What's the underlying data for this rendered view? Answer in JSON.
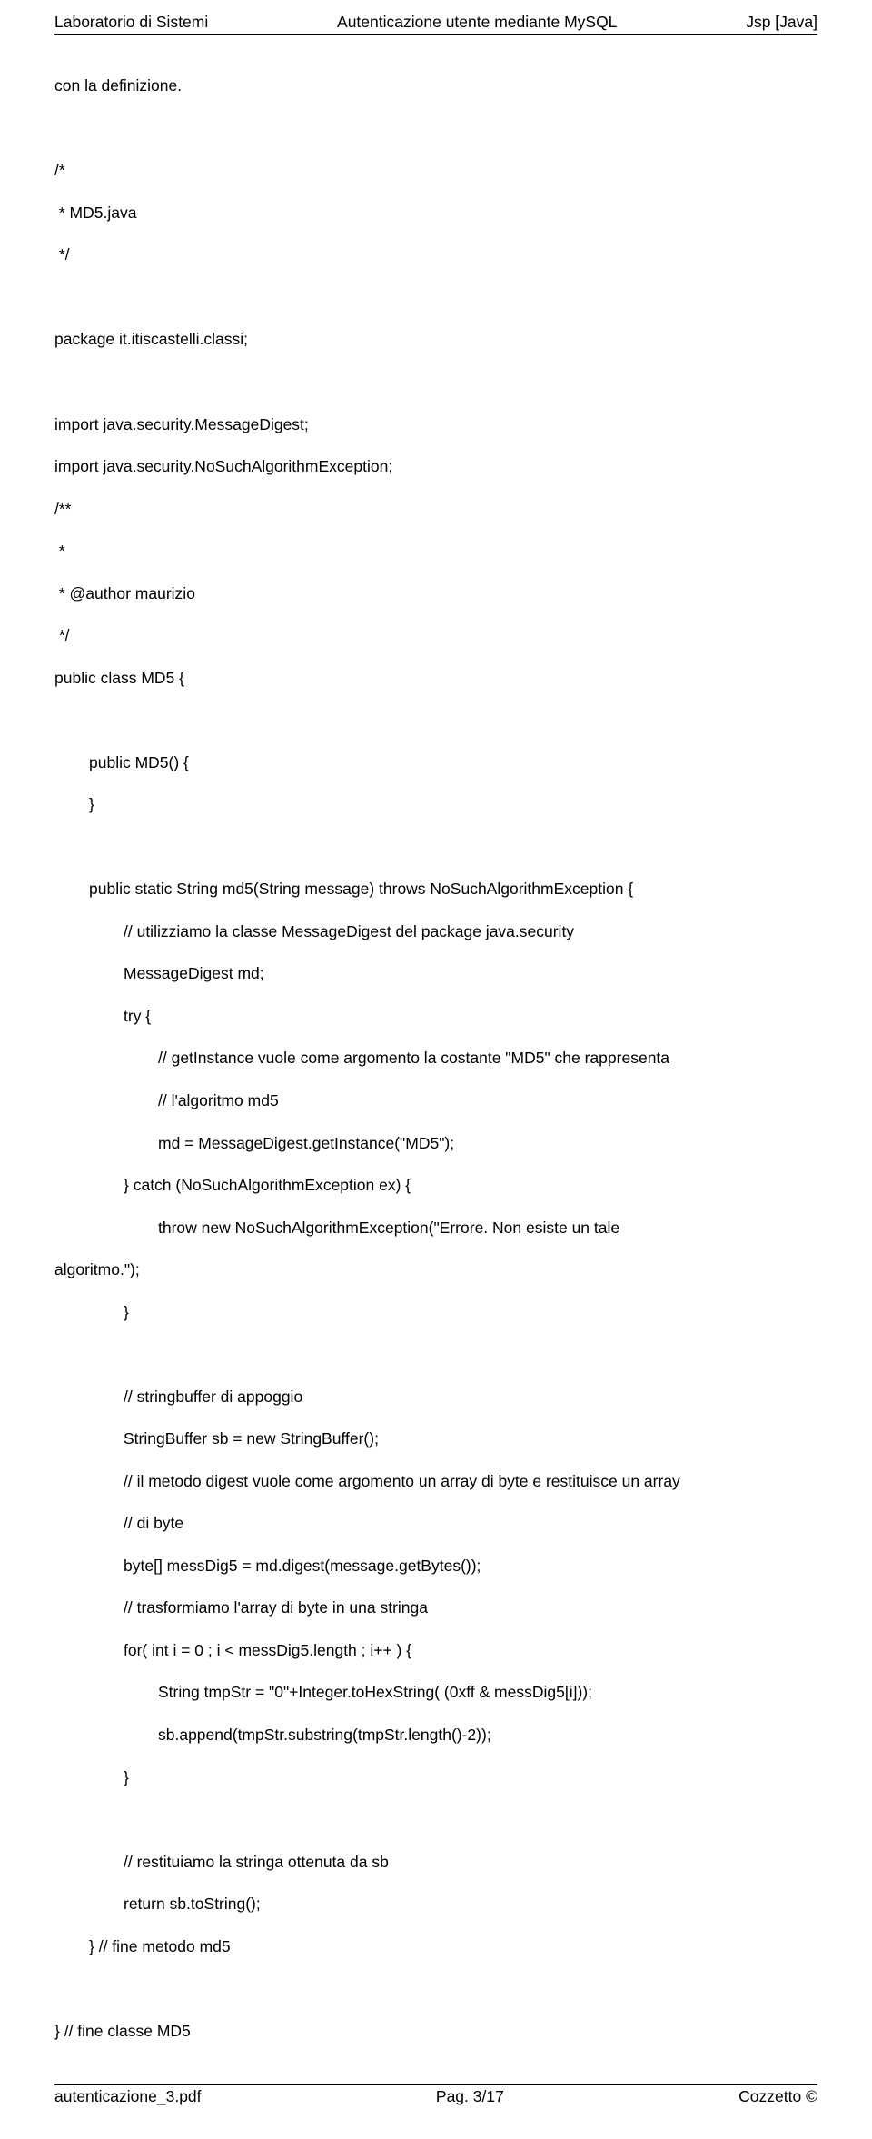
{
  "header": {
    "left": "Laboratorio di Sistemi",
    "center": "Autenticazione utente mediante MySQL",
    "right": "Jsp [Java]"
  },
  "intro": "con la definizione.",
  "code": {
    "c1": "/*",
    "c2": " * MD5.java",
    "c3": " */",
    "pkg": "package it.itiscastelli.classi;",
    "imp1": "import java.security.MessageDigest;",
    "imp2": "import java.security.NoSuchAlgorithmException;",
    "doc1": "/**",
    "doc2": " *",
    "doc3": " * @author maurizio",
    "doc4": " */",
    "cls1": "public class MD5 {",
    "ctor1": "public MD5() {",
    "ctor2": "}",
    "m1": "public static String md5(String message) throws NoSuchAlgorithmException {",
    "m2": "// utilizziamo la classe MessageDigest del package java.security",
    "m3": "MessageDigest md;",
    "m4": "try {",
    "m5": "// getInstance vuole come argomento la costante \"MD5\" che rappresenta",
    "m6": "// l'algoritmo md5",
    "m7": "md = MessageDigest.getInstance(\"MD5\");",
    "m8": "} catch (NoSuchAlgorithmException ex) {",
    "m9": "throw new NoSuchAlgorithmException(\"Errore. Non esiste un tale",
    "m9b": "algoritmo.\");",
    "m10": "}",
    "m11": "// stringbuffer di appoggio",
    "m12": "StringBuffer sb = new StringBuffer();",
    "m13": "// il metodo digest vuole come argomento un array di byte e restituisce un array",
    "m14": "// di byte",
    "m15": "byte[] messDig5 = md.digest(message.getBytes());",
    "m16": "// trasformiamo l'array di byte in una stringa",
    "m17": "for( int i = 0 ; i < messDig5.length ; i++ ) {",
    "m18": "String tmpStr = \"0\"+Integer.toHexString( (0xff & messDig5[i]));",
    "m19": "sb.append(tmpStr.substring(tmpStr.length()-2));",
    "m20": "}",
    "m21": "// restituiamo la stringa ottenuta da sb",
    "m22": "return sb.toString();",
    "m23": "} // fine metodo md5",
    "cls2": "} // fine classe MD5"
  },
  "footer": {
    "left": "autenticazione_3.pdf",
    "center": "Pag. 3/17",
    "right": "Cozzetto ©"
  }
}
